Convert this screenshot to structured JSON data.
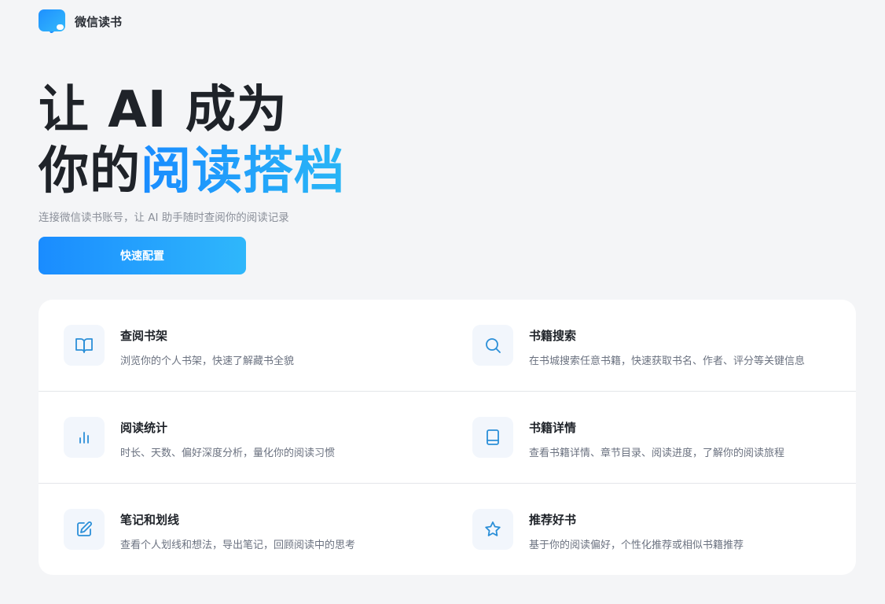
{
  "header": {
    "brand": "微信读书",
    "logo_icon": "chat-book-logo-icon"
  },
  "hero": {
    "line1": "让 AI 成为",
    "line2_plain": "你的",
    "line2_accent": "阅读搭档",
    "subtitle": "连接微信读书账号，让 AI 助手随时查阅你的阅读记录",
    "cta_label": "快速配置"
  },
  "colors": {
    "accent_start": "#1a8cff",
    "accent_end": "#29b6f6",
    "icon_stroke": "#2b8fd8",
    "text_dark": "#1f2329",
    "text_muted": "#6b7280"
  },
  "features": [
    {
      "icon": "book-open-icon",
      "title": "查阅书架",
      "desc": "浏览你的个人书架，快速了解藏书全貌"
    },
    {
      "icon": "search-icon",
      "title": "书籍搜索",
      "desc": "在书城搜索任意书籍，快速获取书名、作者、评分等关键信息"
    },
    {
      "icon": "bar-chart-icon",
      "title": "阅读统计",
      "desc": "时长、天数、偏好深度分析，量化你的阅读习惯"
    },
    {
      "icon": "book-icon",
      "title": "书籍详情",
      "desc": "查看书籍详情、章节目录、阅读进度，了解你的阅读旅程"
    },
    {
      "icon": "edit-note-icon",
      "title": "笔记和划线",
      "desc": "查看个人划线和想法，导出笔记，回顾阅读中的思考"
    },
    {
      "icon": "star-icon",
      "title": "推荐好书",
      "desc": "基于你的阅读偏好，个性化推荐或相似书籍推荐"
    }
  ]
}
